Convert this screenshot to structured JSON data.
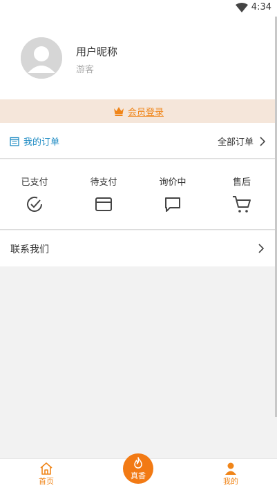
{
  "status_bar": {
    "time": "4:34",
    "wifi_icon": "wifi-icon"
  },
  "profile": {
    "nickname": "用户昵称",
    "subtitle": "游客",
    "avatar_icon": "user-avatar-icon"
  },
  "member": {
    "label": "会员登录",
    "icon": "crown-icon",
    "color": "#f08519",
    "background": "#f5e6da"
  },
  "orders": {
    "title": "我的订单",
    "title_icon": "calendar-icon",
    "all_label": "全部订单",
    "types": [
      {
        "label": "已支付",
        "icon": "check-circle-icon"
      },
      {
        "label": "待支付",
        "icon": "card-icon"
      },
      {
        "label": "询价中",
        "icon": "chat-icon"
      },
      {
        "label": "售后",
        "icon": "cart-icon"
      }
    ]
  },
  "contact": {
    "label": "联系我们"
  },
  "tabbar": {
    "accent": "#f08519",
    "tabs": [
      {
        "label": "首页",
        "icon": "home-icon"
      },
      {
        "label": "真香",
        "icon": "flame-icon"
      },
      {
        "label": "我的",
        "icon": "person-icon"
      }
    ]
  }
}
